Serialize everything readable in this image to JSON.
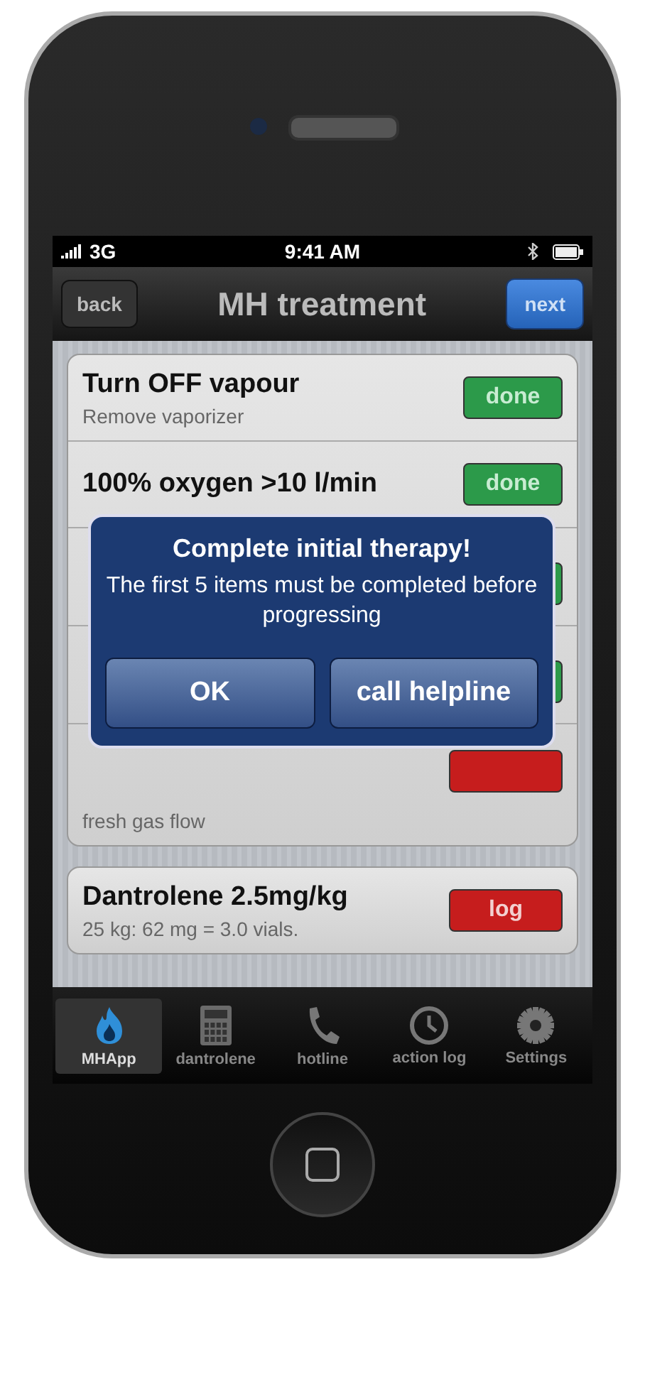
{
  "status_bar": {
    "carrier": "3G",
    "time": "9:41 AM"
  },
  "nav": {
    "back": "back",
    "title": "MH treatment",
    "next": "next"
  },
  "steps": [
    {
      "title": "Turn OFF vapour",
      "subtitle": "Remove vaporizer",
      "button": "done",
      "done": true
    },
    {
      "title": "100% oxygen >10 l/min",
      "button": "done",
      "done": true
    },
    {
      "done": true
    },
    {
      "done": true
    },
    {
      "subtitle": "fresh gas flow",
      "done": false
    }
  ],
  "dose": {
    "title": "Dantrolene 2.5mg/kg",
    "subtitle": "25 kg: 62 mg = 3.0 vials.",
    "button": "log",
    "done": false
  },
  "alert": {
    "title": "Complete initial therapy!",
    "message": "The first 5 items must be completed before progressing",
    "buttons": [
      "OK",
      "call helpline"
    ]
  },
  "tabs": [
    {
      "label": "MHApp",
      "selected": true
    },
    {
      "label": "dantrolene",
      "selected": false
    },
    {
      "label": "hotline",
      "selected": false
    },
    {
      "label": "action log",
      "selected": false
    },
    {
      "label": "Settings",
      "selected": false
    }
  ]
}
